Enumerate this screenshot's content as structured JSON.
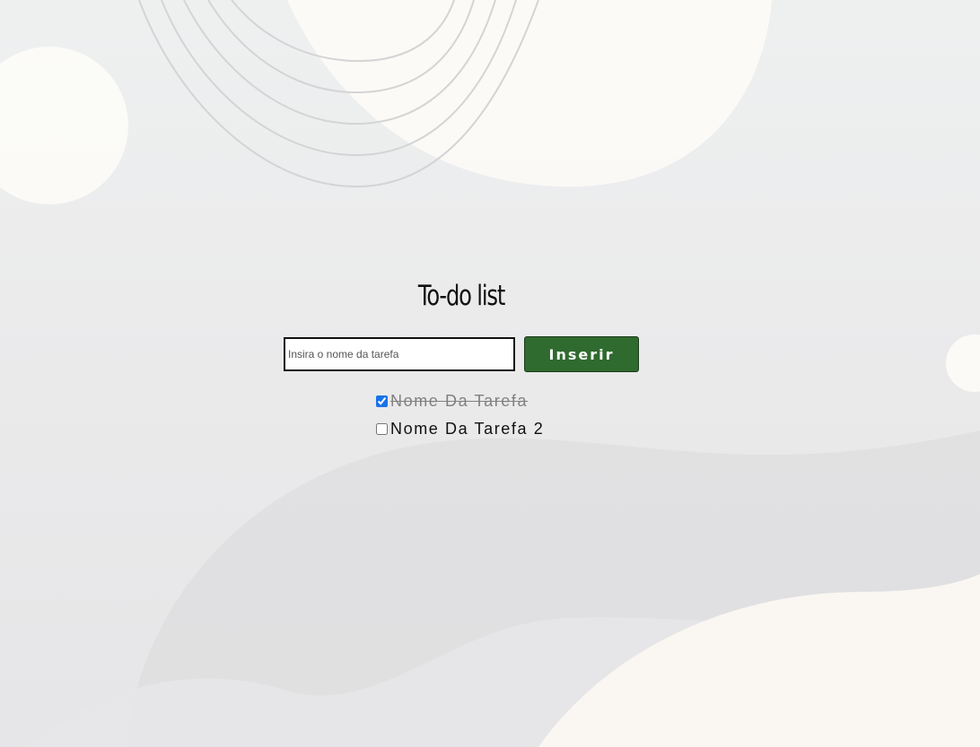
{
  "app": {
    "title": "To-do list"
  },
  "form": {
    "placeholder": "Insira o nome da tarefa",
    "value": "",
    "insert_label": "Inserir",
    "button_color": "#2f6a2e"
  },
  "tasks": [
    {
      "label": "Nome Da Tarefa",
      "done": true
    },
    {
      "label": "Nome Da Tarefa 2",
      "done": false
    }
  ],
  "colors": {
    "accent_green": "#2f6a2e",
    "completed_text": "#808080",
    "background": "#ebebec"
  }
}
